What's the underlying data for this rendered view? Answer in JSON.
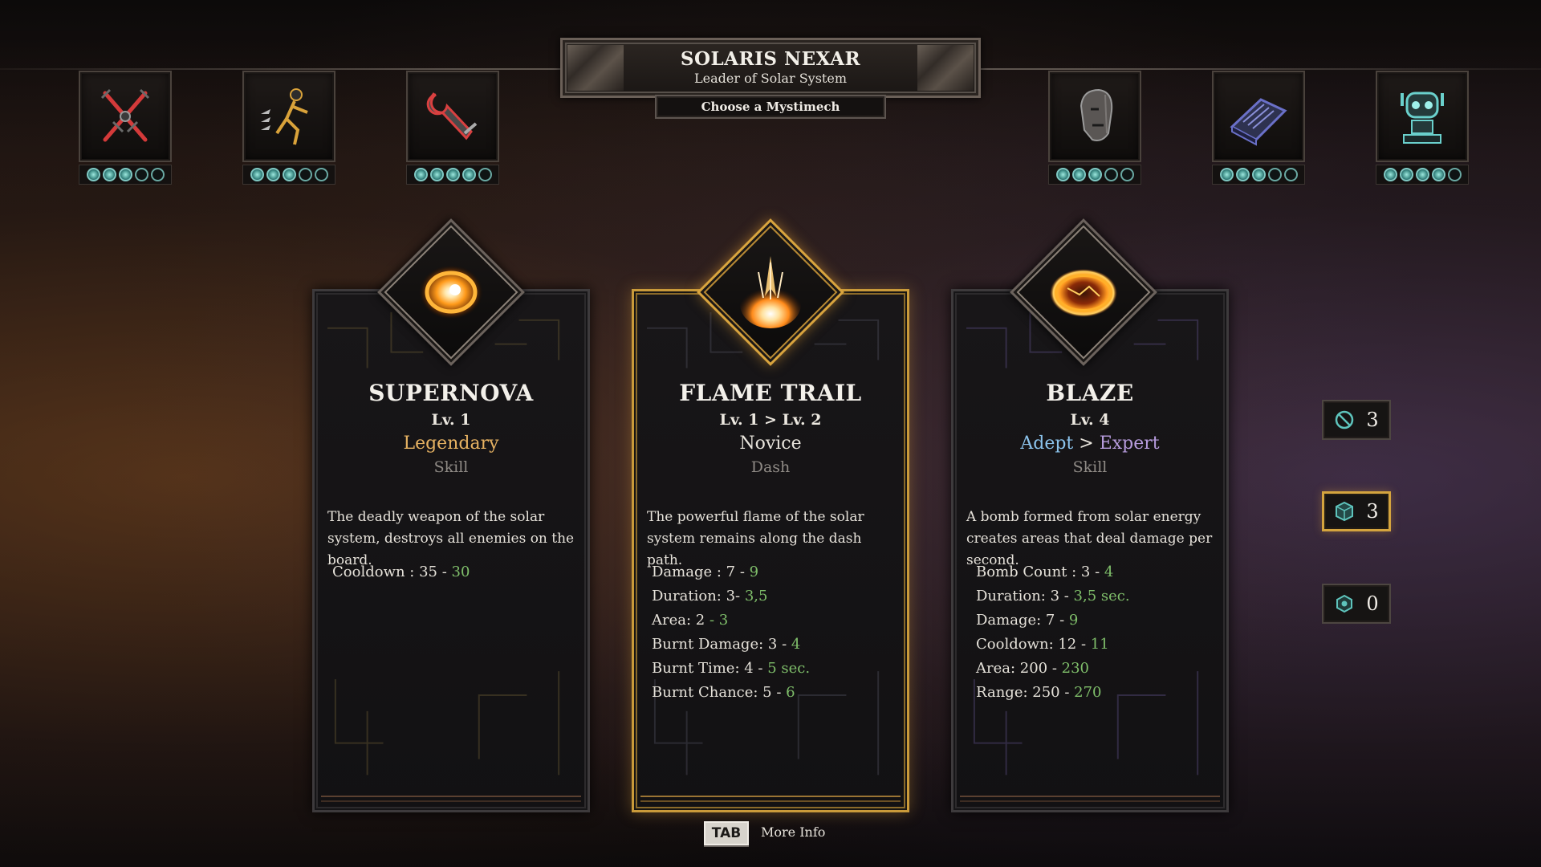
{
  "header": {
    "name": "SOLARIS NEXAR",
    "subtitle": "Leader of Solar System",
    "prompt": "Choose a Mystimech"
  },
  "mystimechs": [
    {
      "icon": "crossed-swords-icon",
      "color": "#d43a3a",
      "filled": 3,
      "total": 5
    },
    {
      "icon": "dashing-figure-icon",
      "color": "#d9a23a",
      "filled": 3,
      "total": 5
    },
    {
      "icon": "wrench-icon",
      "color": "#d94040",
      "filled": 4,
      "total": 5
    },
    {
      "icon": "masked-head-icon",
      "color": "#9a9a9a",
      "filled": 3,
      "total": 5
    },
    {
      "icon": "spellbook-icon",
      "color": "#6a70c8",
      "filled": 3,
      "total": 5
    },
    {
      "icon": "robot-icon",
      "color": "#6ad0cc",
      "filled": 4,
      "total": 5
    }
  ],
  "cards": [
    {
      "icon": "supernova-icon",
      "title": "SUPERNOVA",
      "level": "Lv. 1",
      "rarity": "Legendary",
      "kind": "Skill",
      "description": "The deadly weapon of the solar system, destroys all enemies on the board.",
      "stats": [
        {
          "label": "Cooldown : 35 - ",
          "next": "30"
        }
      ]
    },
    {
      "icon": "flame-trail-icon",
      "title": "FLAME TRAIL",
      "level": "Lv. 1 > Lv. 2",
      "rarity": "Novice",
      "kind": "Dash",
      "description": "The powerful flame of the solar system remains along the dash path.",
      "stats": [
        {
          "label": "Damage : 7 - ",
          "next": "9"
        },
        {
          "label": "Duration: 3- ",
          "next": "3,5"
        },
        {
          "label": "Area: 2 ",
          "next": "- 3"
        },
        {
          "label": "Burnt Damage: 3 - ",
          "next": "4"
        },
        {
          "label": "Burnt Time: 4 - ",
          "next": "5 sec."
        },
        {
          "label": "Burnt Chance: 5 - ",
          "next": "6"
        }
      ]
    },
    {
      "icon": "blaze-icon",
      "title": "BLAZE",
      "level": "Lv. 4",
      "rarity_from": "Adept",
      "rarity_sep": ">",
      "rarity_to": "Expert",
      "kind": "Skill",
      "description": "A bomb formed from solar energy creates areas that deal damage per second.",
      "stats": [
        {
          "label": "Bomb Count : 3 - ",
          "next": "4"
        },
        {
          "label": "Duration: 3 - ",
          "next": "3,5 sec."
        },
        {
          "label": "Damage: 7 - ",
          "next": "9"
        },
        {
          "label": "Cooldown: 12 - ",
          "next": "11"
        },
        {
          "label": "Area: 200 - ",
          "next": "230"
        },
        {
          "label": "Range: 250 - ",
          "next": "270"
        }
      ]
    }
  ],
  "counters": [
    {
      "icon": "banish-icon",
      "value": "3"
    },
    {
      "icon": "reroll-dice-icon",
      "value": "3"
    },
    {
      "icon": "lock-cube-icon",
      "value": "0"
    }
  ],
  "footer": {
    "key": "TAB",
    "label": "More Info"
  }
}
